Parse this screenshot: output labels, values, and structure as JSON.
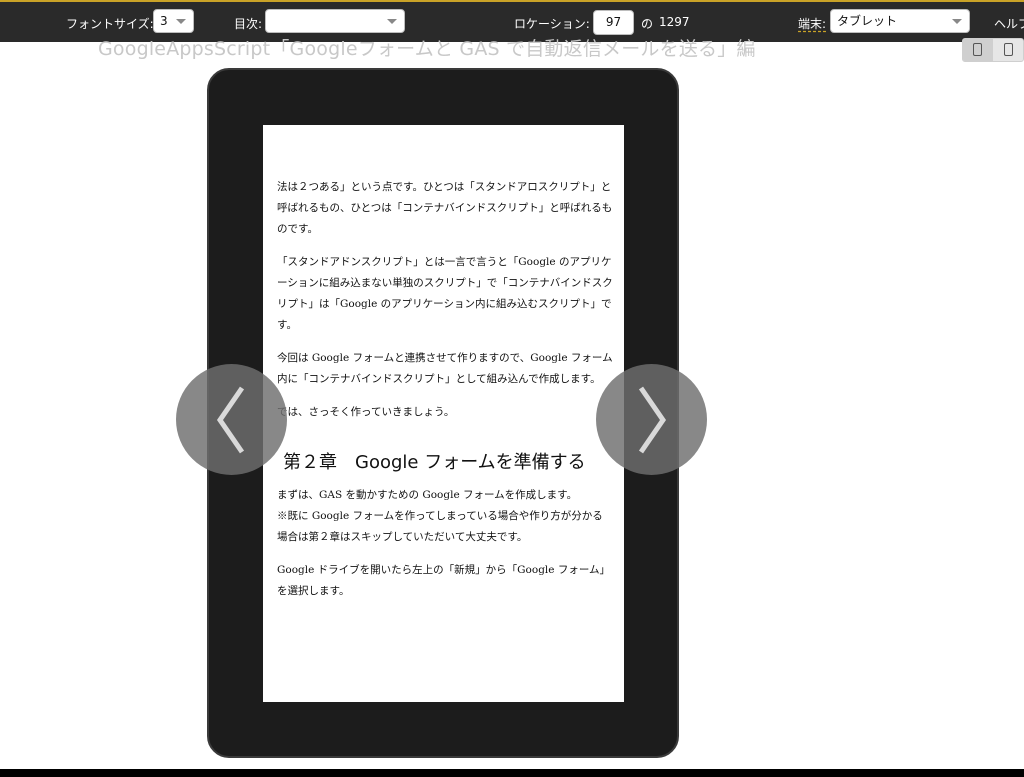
{
  "toolbar": {
    "font_size_label": "フォントサイズ:",
    "font_size_value": "3",
    "toc_label": "目次:",
    "toc_value": "",
    "location_label": "ロケーション:",
    "location_value": "97",
    "location_of": "の",
    "location_total": "1297",
    "device_label": "端末:",
    "device_value": "タブレット",
    "help_label": "ヘルプ"
  },
  "book_title": "GoogleAppsScript「Googleフォームと GAS で自動返信メールを送る」編",
  "page": {
    "paragraphs": [
      "法は２つある」という点です。ひとつは「スタンドアロスクリプト」と呼ばれるもの、ひとつは「コンテナバインドスクリプト」と呼ばれるものです。",
      "「スタンドアドンスクリプト」とは一言で言うと「Google のアプリケーションに組み込まない単独のスクリプト」で「コンテナバインドスクリプト」は「Google のアプリケーション内に組み込むスクリプト」です。",
      "今回は Google フォームと連携させて作りますので、Google フォーム内に「コンテナバインドスクリプト」として組み込んで作成します。",
      "では、さっそく作っていきましょう。"
    ],
    "heading": "第２章　Google フォームを準備する",
    "paragraphs2": [
      "まずは、GAS を動かすための Google フォームを作成します。",
      "※既に Google フォームを作ってしまっている場合や作り方が分かる場合は第２章はスキップしていただいて大丈夫です。",
      "Google ドライブを開いたら左上の「新規」から「Google フォーム」を選択します。"
    ]
  },
  "icons": {
    "prev": "chevron-left-icon",
    "next": "chevron-right-icon",
    "dropdown": "caret-down-icon"
  },
  "colors": {
    "toolbar_bg": "#2a2a2a",
    "accent": "#c9a227",
    "device_frame": "#1c1c1c"
  }
}
